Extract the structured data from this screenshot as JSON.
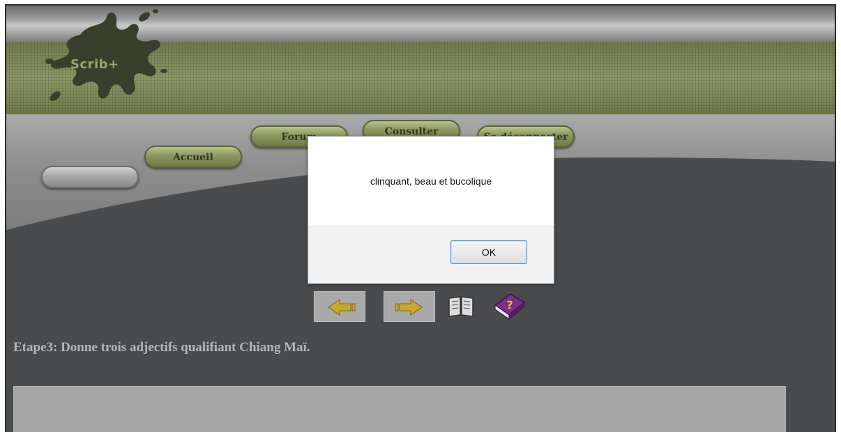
{
  "app": {
    "logo_text": "Scrib+"
  },
  "nav": {
    "items": [
      {
        "label": ""
      },
      {
        "label": "Accueil"
      },
      {
        "label": "Forum"
      },
      {
        "label": "Consulter"
      },
      {
        "label": "Se déconnecter"
      }
    ]
  },
  "toolbar": {
    "icons": [
      "arrow-left-icon",
      "arrow-right-icon",
      "open-book-icon",
      "help-book-icon"
    ]
  },
  "content": {
    "instruction": "Etape3: Donne trois adjectifs qualifiant Chiang Maï."
  },
  "dialog": {
    "message": "clinquant, beau et bucolique",
    "ok_label": "OK"
  },
  "colors": {
    "accent_green": "#8b9660",
    "page_bg": "#4a4b4c",
    "dialog_focus": "#3c8cd6"
  }
}
